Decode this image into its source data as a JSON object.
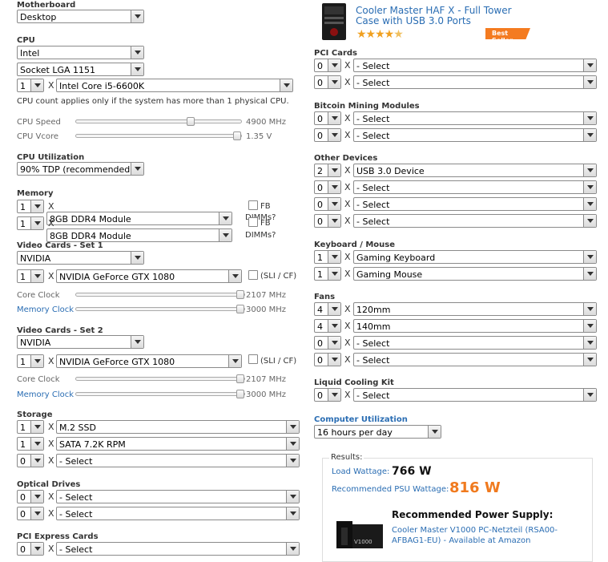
{
  "motherboard": {
    "label": "Motherboard",
    "value": "Desktop"
  },
  "cpu": {
    "label": "CPU",
    "brand": "Intel",
    "socket": "Socket LGA 1151",
    "count": "1",
    "x": "X",
    "model": "Intel Core i5-6600K",
    "note": "CPU count applies only if the system has more than 1 physical CPU.",
    "speed_label": "CPU Speed",
    "speed_value": "4900 MHz",
    "vcore_label": "CPU Vcore",
    "vcore_value": "1.35 V"
  },
  "cpu_util": {
    "label": "CPU Utilization",
    "value": "90% TDP (recommended)"
  },
  "memory": {
    "label": "Memory",
    "rows": [
      {
        "count": "1",
        "x": "X",
        "module": "8GB DDR4 Module",
        "fb": "FB",
        "dimms": "DIMMs?"
      },
      {
        "count": "1",
        "x": "X",
        "module": "8GB DDR4 Module",
        "fb": "FB",
        "dimms": "DIMMs?"
      }
    ]
  },
  "video1": {
    "label": "Video Cards - Set 1",
    "brand": "NVIDIA",
    "count": "1",
    "x": "X",
    "model": "NVIDIA GeForce GTX 1080",
    "sli": "(SLI / CF)",
    "core_label": "Core Clock",
    "core_value": "2107 MHz",
    "mem_label": "Memory Clock",
    "mem_value": "3000 MHz"
  },
  "video2": {
    "label": "Video Cards - Set 2",
    "brand": "NVIDIA",
    "count": "1",
    "x": "X",
    "model": "NVIDIA GeForce GTX 1080",
    "sli": "(SLI / CF)",
    "core_label": "Core Clock",
    "core_value": "2107 MHz",
    "mem_label": "Memory Clock",
    "mem_value": "3000 MHz"
  },
  "storage": {
    "label": "Storage",
    "rows": [
      {
        "count": "1",
        "x": "X",
        "value": "M.2 SSD"
      },
      {
        "count": "1",
        "x": "X",
        "value": "SATA 7.2K RPM"
      },
      {
        "count": "0",
        "x": "X",
        "value": "- Select"
      }
    ]
  },
  "optical": {
    "label": "Optical Drives",
    "rows": [
      {
        "count": "0",
        "x": "X",
        "value": "- Select"
      },
      {
        "count": "0",
        "x": "X",
        "value": "- Select"
      }
    ]
  },
  "pcie": {
    "label": "PCI Express Cards",
    "rows": [
      {
        "count": "0",
        "x": "X",
        "value": "- Select"
      }
    ]
  },
  "product": {
    "title_line1": "Cooler Master HAF X - Full Tower",
    "title_line2": "Case with USB 3.0 Ports",
    "badge": "Best Seller",
    "rating": 4.5
  },
  "pci": {
    "label": "PCI Cards",
    "rows": [
      {
        "count": "0",
        "x": "X",
        "value": "- Select"
      },
      {
        "count": "0",
        "x": "X",
        "value": "- Select"
      }
    ]
  },
  "bitcoin": {
    "label": "Bitcoin Mining Modules",
    "rows": [
      {
        "count": "0",
        "x": "X",
        "value": "- Select"
      },
      {
        "count": "0",
        "x": "X",
        "value": "- Select"
      }
    ]
  },
  "other": {
    "label": "Other Devices",
    "rows": [
      {
        "count": "2",
        "x": "X",
        "value": "USB 3.0 Device"
      },
      {
        "count": "0",
        "x": "X",
        "value": "- Select"
      },
      {
        "count": "0",
        "x": "X",
        "value": "- Select"
      },
      {
        "count": "0",
        "x": "X",
        "value": "- Select"
      }
    ]
  },
  "keyboard": {
    "label": "Keyboard / Mouse",
    "rows": [
      {
        "count": "1",
        "x": "X",
        "value": "Gaming Keyboard"
      },
      {
        "count": "1",
        "x": "X",
        "value": "Gaming Mouse"
      }
    ]
  },
  "fans": {
    "label": "Fans",
    "rows": [
      {
        "count": "4",
        "x": "X",
        "value": "120mm"
      },
      {
        "count": "4",
        "x": "X",
        "value": "140mm"
      },
      {
        "count": "0",
        "x": "X",
        "value": "- Select"
      },
      {
        "count": "0",
        "x": "X",
        "value": "- Select"
      }
    ]
  },
  "liquid": {
    "label": "Liquid Cooling Kit",
    "rows": [
      {
        "count": "0",
        "x": "X",
        "value": "- Select"
      }
    ]
  },
  "util": {
    "label": "Computer Utilization",
    "value": "16 hours per day"
  },
  "results": {
    "label": "Results:",
    "load_label": "Load Wattage:",
    "load_value": "766 W",
    "psu_label": "Recommended PSU Wattage:",
    "psu_value": "816 W",
    "rec_title": "Recommended Power Supply:",
    "rec_line1": "Cooler Master V1000 PC-Netzteil (RSA00-",
    "rec_line2": "AFBAG1-EU) - Available at Amazon",
    "psu_brand": "V1000"
  },
  "colors": {
    "blue": "#2a6db3",
    "orange": "#f07a1e",
    "badge": "#f47b20"
  }
}
